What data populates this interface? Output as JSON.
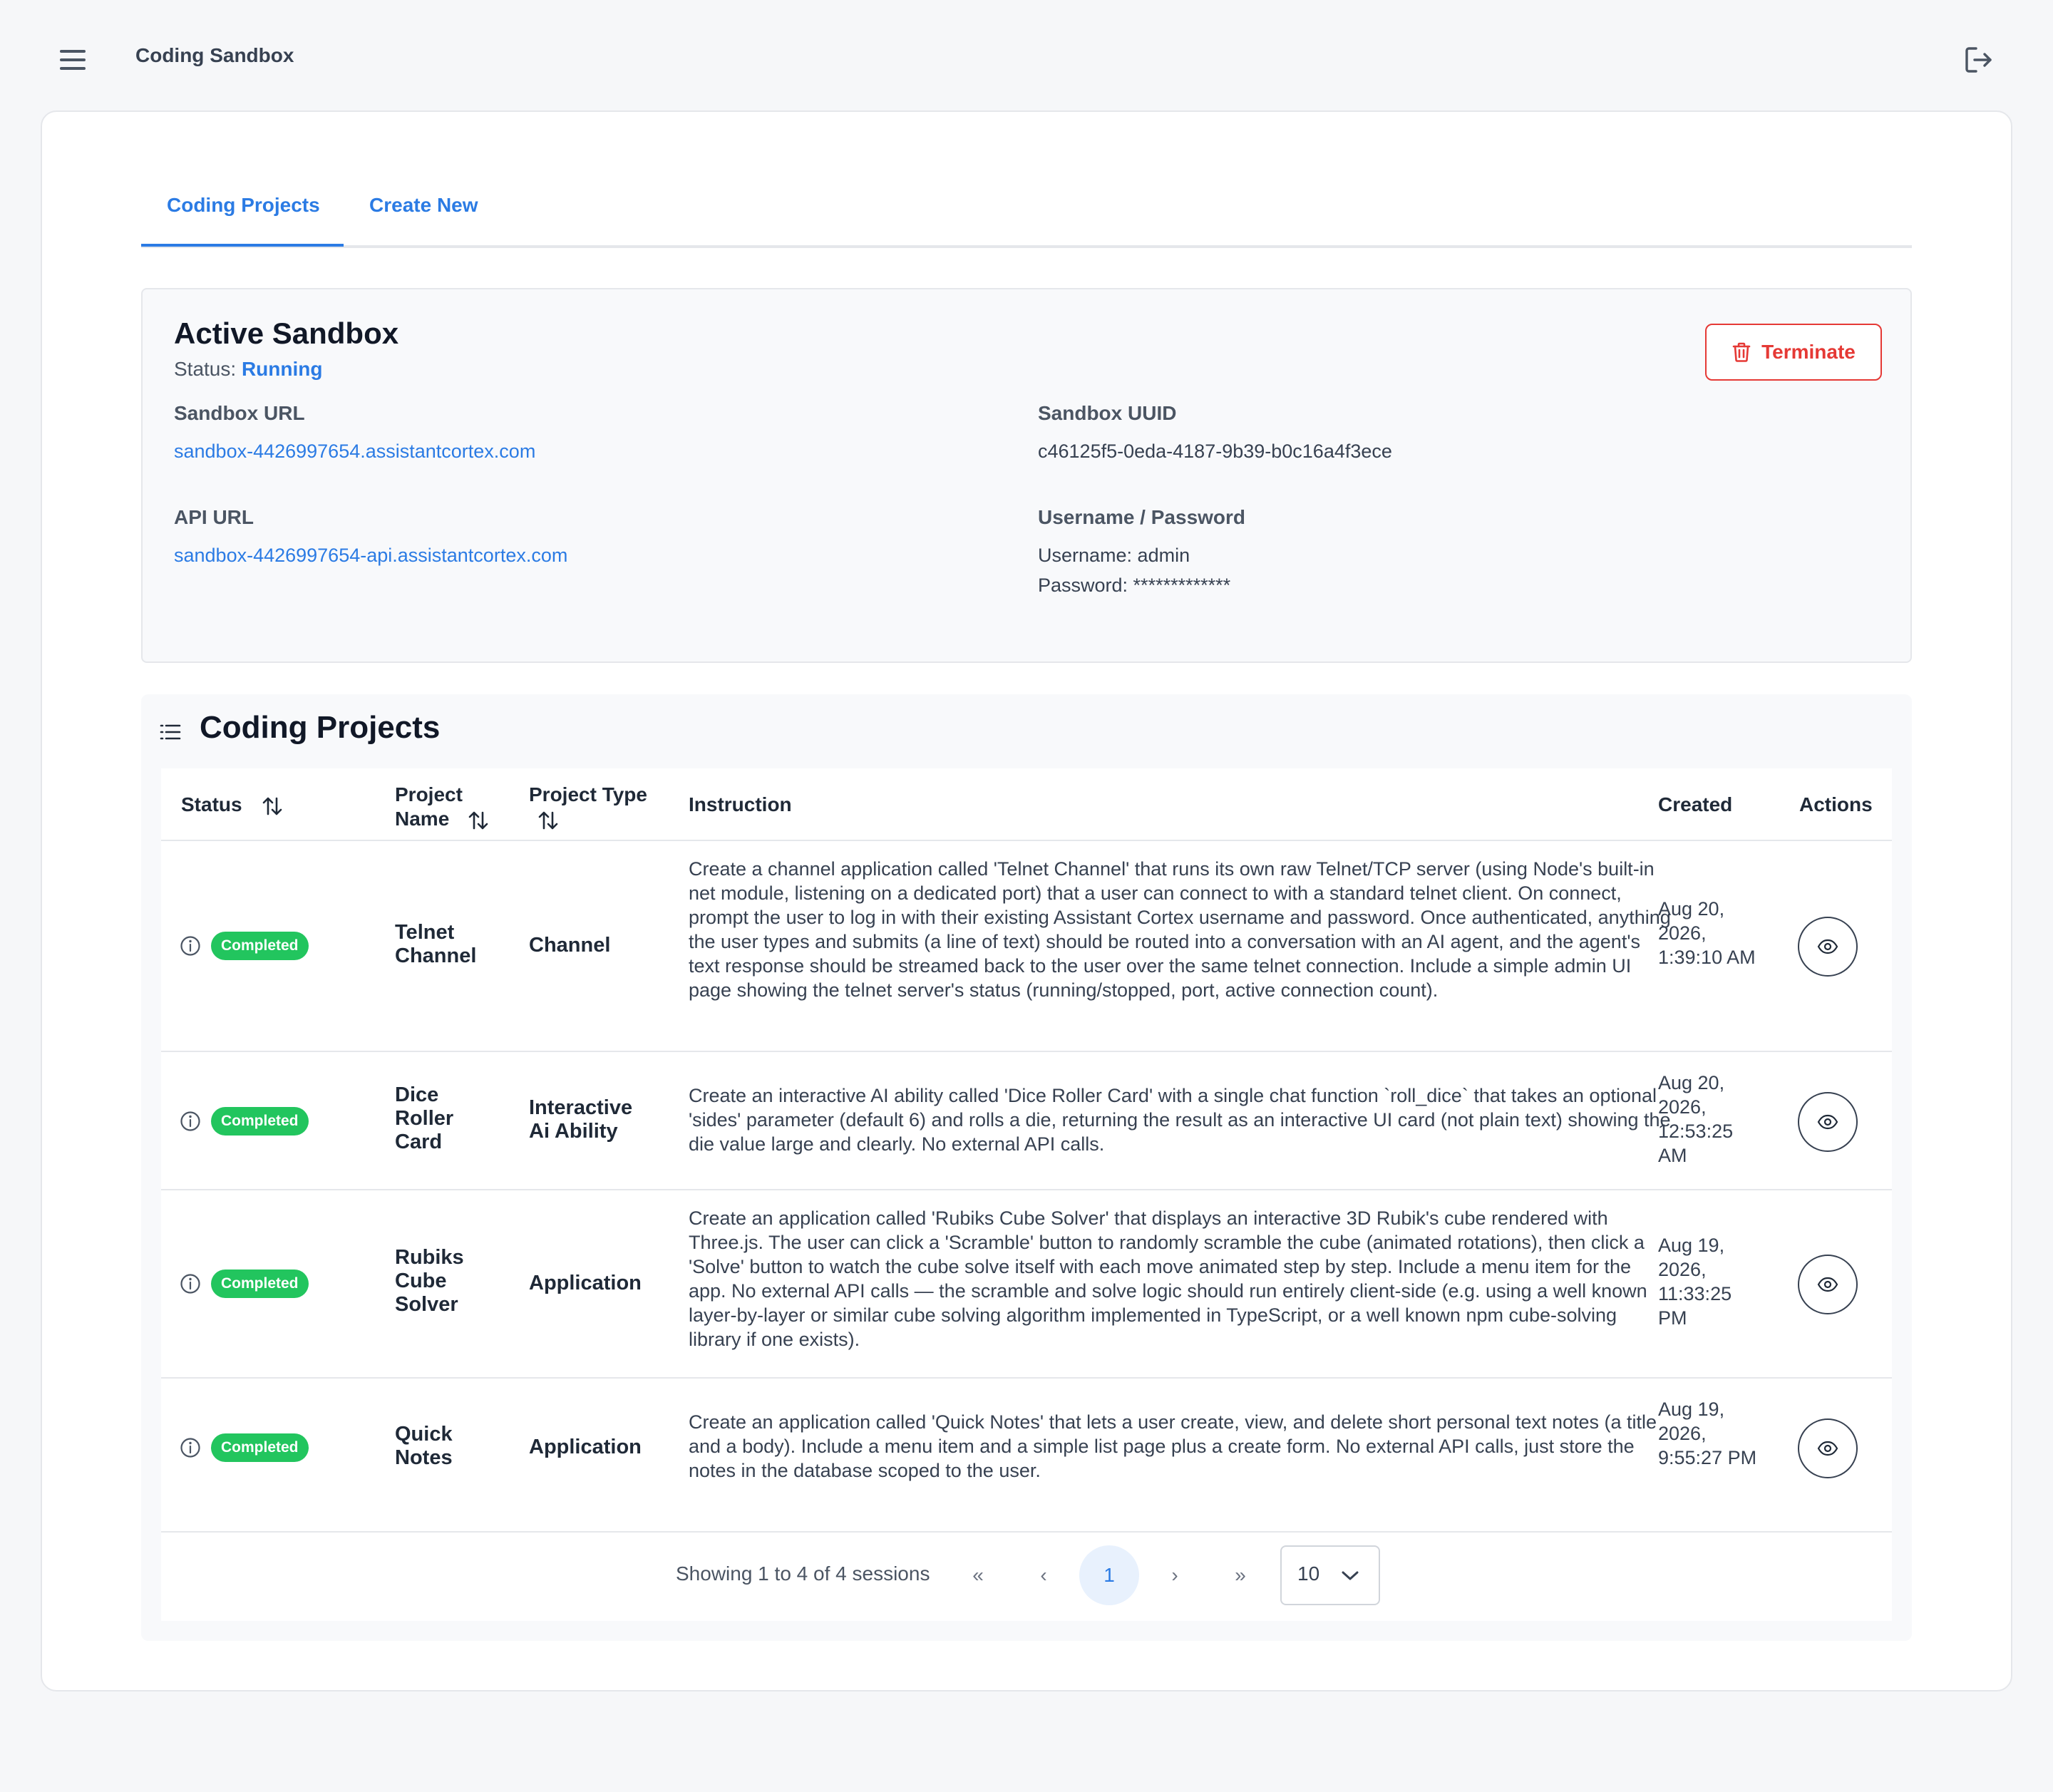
{
  "app": {
    "title": "Coding Sandbox"
  },
  "tabs": [
    {
      "label": "Coding Projects"
    },
    {
      "label": "Create New"
    }
  ],
  "sandbox": {
    "title": "Active Sandbox",
    "status_label": "Status:",
    "status_value": "Running",
    "terminate_label": "Terminate",
    "url_label": "Sandbox URL",
    "url_value": "sandbox-4426997654.assistantcortex.com",
    "uuid_label": "Sandbox UUID",
    "uuid_value": "c46125f5-0eda-4187-9b39-b0c16a4f3ece",
    "api_label": "API URL",
    "api_value": "sandbox-4426997654-api.assistantcortex.com",
    "creds_label": "Username / Password",
    "username": "Username: admin",
    "password": "Password: *************"
  },
  "projects": {
    "title": "Coding Projects",
    "headers": {
      "status": "Status",
      "name_line1": "Project",
      "name_line2": "Name",
      "type": "Project Type",
      "instruction": "Instruction",
      "created": "Created",
      "actions": "Actions"
    },
    "rows": [
      {
        "status": "Completed",
        "name": "Telnet Channel",
        "type": "Channel",
        "instruction": "Create a channel application called 'Telnet Channel' that runs its own raw Telnet/TCP server (using Node's built-in net module, listening on a dedicated port) that a user can connect to with a standard telnet client. On connect, prompt the user to log in with their existing Assistant Cortex username and password. Once authenticated, anything the user types and submits (a line of text) should be routed into a conversation with an AI agent, and the agent's text response should be streamed back to the user over the same telnet connection. Include a simple admin UI page showing the telnet server's status (running/stopped, port, active connection count).",
        "created": "Aug 20, 2026, 1:39:10 AM"
      },
      {
        "status": "Completed",
        "name": "Dice Roller Card",
        "type": "Interactive Ai Ability",
        "instruction": "Create an interactive AI ability called 'Dice Roller Card' with a single chat function `roll_dice` that takes an optional 'sides' parameter (default 6) and rolls a die, returning the result as an interactive UI card (not plain text) showing the die value large and clearly. No external API calls.",
        "created": "Aug 20, 2026, 12:53:25 AM"
      },
      {
        "status": "Completed",
        "name": "Rubiks Cube Solver",
        "type": "Application",
        "instruction": "Create an application called 'Rubiks Cube Solver' that displays an interactive 3D Rubik's cube rendered with Three.js. The user can click a 'Scramble' button to randomly scramble the cube (animated rotations), then click a 'Solve' button to watch the cube solve itself with each move animated step by step. Include a menu item for the app. No external API calls — the scramble and solve logic should run entirely client-side (e.g. using a well known layer-by-layer or similar cube solving algorithm implemented in TypeScript, or a well known npm cube-solving library if one exists).",
        "created": "Aug 19, 2026, 11:33:25 PM"
      },
      {
        "status": "Completed",
        "name": "Quick Notes",
        "type": "Application",
        "instruction": "Create an application called 'Quick Notes' that lets a user create, view, and delete short personal text notes (a title and a body). Include a menu item and a simple list page plus a create form. No external API calls, just store the notes in the database scoped to the user.",
        "created": "Aug 19, 2026, 9:55:27 PM"
      }
    ],
    "pagination": {
      "summary": "Showing 1 to 4 of 4 sessions",
      "first": "«",
      "prev": "‹",
      "current_page": "1",
      "next": "›",
      "last": "»",
      "per_page": "10"
    }
  },
  "colors": {
    "accent": "#2b7be4",
    "danger": "#e53935",
    "success": "#22c55e"
  },
  "icons": [
    "menu-icon",
    "logout-icon",
    "trash-icon",
    "list-icon",
    "sort-icon",
    "info-icon",
    "eye-icon",
    "chevron-down-icon"
  ]
}
